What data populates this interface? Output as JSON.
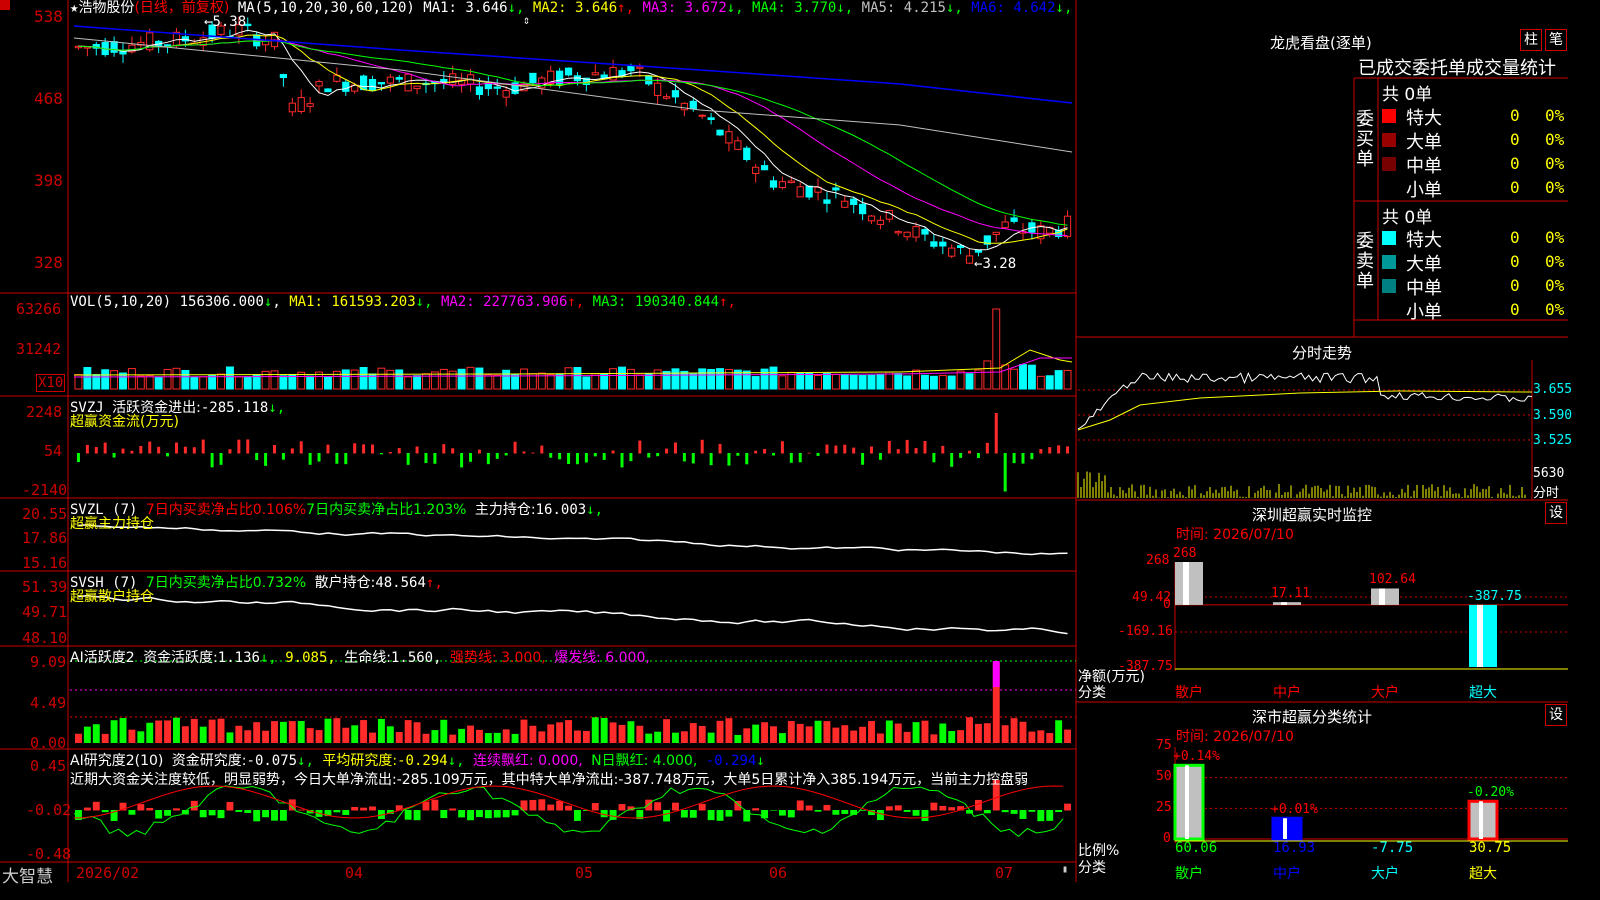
{
  "main_chart": {
    "title": "浩物股份",
    "period": "(日线，前复权)",
    "ma_label": "MA(5,10,20,30,60,120)",
    "ma": [
      {
        "name": "MA1:",
        "value": "3.646",
        "arrow": "↓",
        "color": "#ffffff"
      },
      {
        "name": "MA2:",
        "value": "3.646",
        "arrow": "↑",
        "color": "#ffff00"
      },
      {
        "name": "MA3:",
        "value": "3.672",
        "arrow": "↓",
        "color": "#ff00ff"
      },
      {
        "name": "MA4:",
        "value": "3.770",
        "arrow": "↓",
        "color": "#00ff00"
      },
      {
        "name": "MA5:",
        "value": "4.215",
        "arrow": "↓",
        "color": "#c0c0c0"
      },
      {
        "name": "MA6:",
        "value": "4.642",
        "arrow": "↓",
        "color": "#0000ff"
      }
    ],
    "y_ticks": [
      "538",
      "468",
      "398",
      "328"
    ],
    "high_label": "5.38",
    "low_label": "3.28"
  },
  "vol_panel": {
    "label": "VOL(5,10,20)",
    "value": "156306.000",
    "value_arrow": "↓",
    "mas": [
      {
        "name": "MA1:",
        "value": "161593.203",
        "arrow": "↓",
        "color": "#ffff00"
      },
      {
        "name": "MA2:",
        "value": "227763.906",
        "arrow": "↑",
        "color": "#ff00ff"
      },
      {
        "name": "MA3:",
        "value": "190340.844",
        "arrow": "↑",
        "color": "#00ff00"
      }
    ],
    "y_ticks": [
      "63266",
      "31242"
    ],
    "unit": "X10"
  },
  "svzj_panel": {
    "label": "SVZJ",
    "desc": "活跃资金进出:",
    "value": "-285.118",
    "arrow": "↓,",
    "subtitle": "超赢资金流(万元)",
    "y_ticks": [
      "2248",
      "54",
      "-2140"
    ]
  },
  "svzl_panel": {
    "label": "SVZL (7)",
    "buy_text": "7日内买卖净占比0.106%",
    "buy_text2": "7日内买卖净占比1.203%",
    "hold_label": "主力持仓:",
    "hold_value": "16.003",
    "hold_arrow": "↓,",
    "subtitle": "超赢主力持仓",
    "y_ticks": [
      "20.55",
      "17.86",
      "15.16"
    ]
  },
  "svsh_panel": {
    "label": "SVSH (7)",
    "buy_text": "7日内买卖净占比0.732%",
    "hold_label": "散户持仓:",
    "hold_value": "48.564",
    "hold_arrow": "↑,",
    "subtitle": "超赢散户持仓",
    "y_ticks": [
      "51.39",
      "49.71",
      "48.10"
    ]
  },
  "ai_active_panel": {
    "label": "AI活跃度2",
    "act_label": "资金活跃度:",
    "act_value": "1.136",
    "act_arrow": "↓,",
    "val2": "9.085,",
    "life_label": "生命线:",
    "life_value": "1.560,",
    "strong": "强势线: 3.000,",
    "burst": "爆发线: 6.000,",
    "y_ticks": [
      "9.09",
      "4.49",
      "0.00"
    ]
  },
  "ai_research_panel": {
    "label": "AI研究度2(10)",
    "r_label": "资金研究度:",
    "r_value": "-0.075",
    "r_arrow": "↓,",
    "avg_label": "平均研究度:",
    "avg_value": "-0.294",
    "avg_arrow": "↓,",
    "red1": "连续飘红: 0.000,",
    "red2": "N日飘红: 4.000,",
    "last": "-0.294",
    "last_arrow": "↓",
    "comment": "近期大资金关注度较低，明显弱势，今日大单净流出:-285.109万元，其中特大单净流出:-387.748万元，大单5日累计净入385.194万元，当前主力控盘弱",
    "y_ticks": [
      "0.45",
      "-0.02",
      "-0.48"
    ]
  },
  "x_axis": {
    "brand": "大智慧",
    "labels": [
      "2026/02",
      "04",
      "05",
      "06",
      "07"
    ]
  },
  "right_panel": {
    "lhb_title": "龙虎看盘(逐单)",
    "tab1": "柱",
    "tab2": "笔",
    "table_header": "已成交委托单成交量统计",
    "buy_group": "委买单",
    "sell_group": "委卖单",
    "buy_total": "共 0单",
    "sell_total": "共 0单",
    "buy_rows": [
      {
        "label": "特大",
        "count": "0",
        "pct": "0%",
        "color": "#ff0000"
      },
      {
        "label": "大单",
        "count": "0",
        "pct": "0%",
        "color": "#990000"
      },
      {
        "label": "中单",
        "count": "0",
        "pct": "0%",
        "color": "#770000"
      },
      {
        "label": "小单",
        "count": "0",
        "pct": "0%",
        "color": ""
      }
    ],
    "sell_rows": [
      {
        "label": "特大",
        "count": "0",
        "pct": "0%",
        "color": "#00ffff"
      },
      {
        "label": "大单",
        "count": "0",
        "pct": "0%",
        "color": "#009999"
      },
      {
        "label": "中单",
        "count": "0",
        "pct": "0%",
        "color": "#008080"
      },
      {
        "label": "小单",
        "count": "0",
        "pct": "0%",
        "color": ""
      }
    ],
    "intraday_title": "分时走势",
    "intraday_ticks": [
      "3.655",
      "3.590",
      "3.525"
    ],
    "intraday_vol": "5630",
    "intraday_foot": "分时",
    "monitor_title": "深圳超赢实时监控",
    "monitor_time": "时间: 2026/07/10",
    "monitor_set": "设",
    "monitor_y": [
      "268",
      "49.42",
      "0",
      "-169.16",
      "-387.75"
    ],
    "monitor_unit": "净额(万元)",
    "monitor_cat_label": "分类",
    "class_title": "深市超赢分类统计",
    "class_time": "时间: 2026/07/10",
    "class_set": "设",
    "class_y": [
      "75",
      "50",
      "25",
      "0"
    ],
    "class_unit": "比例%",
    "class_cat_label": "分类"
  },
  "chart_data": [
    {
      "type": "bar",
      "title": "深圳超赢实时监控",
      "ylabel": "净额(万元)",
      "categories": [
        "散户",
        "中户",
        "大户",
        "超大"
      ],
      "values": [
        268,
        17.11,
        102.64,
        -387.75
      ],
      "ylim": [
        -387.75,
        268
      ]
    },
    {
      "type": "bar",
      "title": "深市超赢分类统计",
      "ylabel": "比例%",
      "categories": [
        "散户",
        "中户",
        "大户",
        "超大"
      ],
      "values": [
        60.06,
        16.93,
        -7.75,
        30.75
      ],
      "change_labels": [
        "+0.14%",
        "+0.01%",
        "",
        "-0.20%"
      ],
      "ylim": [
        0,
        75
      ]
    },
    {
      "type": "line",
      "title": "浩物股份 (日线，前复权)",
      "x": [
        "2026/02",
        "04",
        "05",
        "06",
        "07"
      ],
      "series": [
        {
          "name": "MA1",
          "values": [
            5.1,
            5.2,
            4.85,
            4.8,
            4.85,
            4.95,
            4.6,
            4.1,
            3.85,
            3.55,
            3.45,
            3.646
          ]
        },
        {
          "name": "MA6",
          "values": [
            5.3,
            5.25,
            5.2,
            5.15,
            5.1,
            5.05,
            5.0,
            4.92,
            4.85,
            4.78,
            4.7,
            4.642
          ]
        }
      ],
      "high": 5.38,
      "low": 3.28,
      "ylim": [
        3.28,
        5.38
      ]
    }
  ]
}
